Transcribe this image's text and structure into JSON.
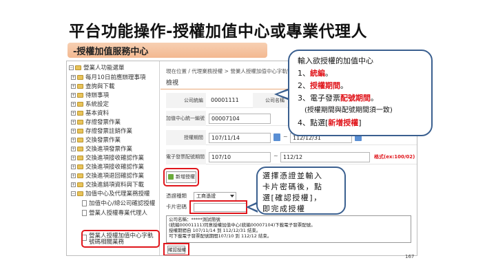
{
  "slide": {
    "title": "平台功能操作-授權加值中心或專業代理人",
    "banner": "-授權加值服務中心",
    "page_number": "167"
  },
  "tree": {
    "root": "營業人功能選單",
    "items": [
      "每月10日前應辦理事項",
      "查詢與下載",
      "待辦事項",
      "系統設定",
      "基本資料",
      "存證發票作業",
      "存證發票註銷作業",
      "交換發票作業",
      "交換進項發票作業",
      "交換進項接收確認作業",
      "交換進項接收確認作業",
      "交換進項退回確認作業",
      "交換進銷項資料與下載",
      "加值中心及代理業務授權"
    ],
    "children": [
      "加值中心/總公司確認授權",
      "營業人授權專業代理人",
      "營業人授權加值中心字軌號碼相關業務"
    ]
  },
  "main": {
    "breadcrumb": "現在位置 / 代理業務授權 > 營業人授權加值中心字軌號碼相關業務",
    "tab": "檢視",
    "company_id_label": "公司統編",
    "company_id": "00001111",
    "company_name_label": "公司名稱",
    "vac_label": "加值中心統一編號",
    "vac_value": "00007104",
    "period_label": "授權期間",
    "period_from": "107/11/14",
    "period_to": "112/12/31",
    "inv_period_label": "電子發票配號期間",
    "inv_from": "107/10",
    "inv_to": "112/12",
    "format_hint": "格式(ex:100/02)",
    "tilde": "~",
    "add_button": "新增授權",
    "cert_label": "憑證種類",
    "cert_value": "工商憑證",
    "card_label": "卡片密碼",
    "info_lines": [
      "公司名稱：*****測試簡號",
      "(統編00001111)同意授權加值中心(統編00007104)下載電子發票配號。",
      "授權期間自 107/11/14 到 112/12/31 結束。",
      "可下載電子發票配號期間107/10 到 112/12 結束。"
    ],
    "confirm_button": "確認授權"
  },
  "callout1": {
    "title": "輸入欲授權的加值中心",
    "l1_prefix": "1、",
    "l1_red": "統編",
    "l1_suffix": "。",
    "l2_prefix": "2、",
    "l2_red": "授權期間",
    "l2_suffix": "。",
    "l3_prefix": "3、電子發票",
    "l3_red": "配號期間",
    "l3_suffix": "。",
    "l3_note": "(授權期間與配號期間須一致)",
    "l4_prefix": "4、點選[",
    "l4_red": "新增授權",
    "l4_suffix": "]"
  },
  "callout2": {
    "line1": "選擇憑證並輸入",
    "line2": "卡片密碼後，點",
    "line3": "選[確認授權]，",
    "line4": "即完成授權"
  }
}
